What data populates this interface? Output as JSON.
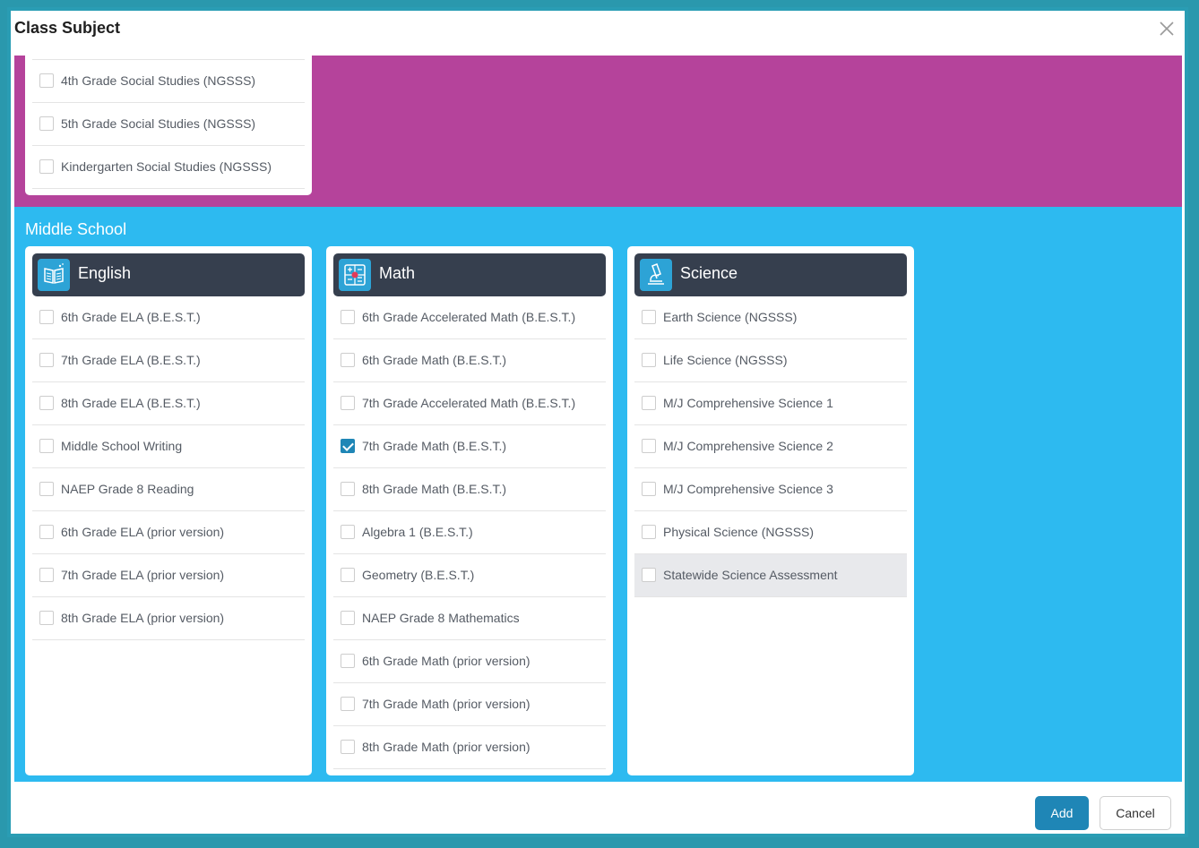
{
  "modal": {
    "title": "Class Subject"
  },
  "elementary_tail": {
    "items": [
      {
        "label": "4th Grade Social Studies (NGSSS)",
        "checked": false
      },
      {
        "label": "5th Grade Social Studies (NGSSS)",
        "checked": false
      },
      {
        "label": "Kindergarten Social Studies (NGSSS)",
        "checked": false
      }
    ]
  },
  "middle_school": {
    "title": "Middle School",
    "english": {
      "label": "English",
      "icon": "book-icon",
      "items": [
        {
          "label": "6th Grade ELA (B.E.S.T.)",
          "checked": false
        },
        {
          "label": "7th Grade ELA (B.E.S.T.)",
          "checked": false
        },
        {
          "label": "8th Grade ELA (B.E.S.T.)",
          "checked": false
        },
        {
          "label": "Middle School Writing",
          "checked": false
        },
        {
          "label": "NAEP Grade 8 Reading",
          "checked": false
        },
        {
          "label": "6th Grade ELA (prior version)",
          "checked": false
        },
        {
          "label": "7th Grade ELA (prior version)",
          "checked": false
        },
        {
          "label": "8th Grade ELA (prior version)",
          "checked": false
        }
      ]
    },
    "math": {
      "label": "Math",
      "icon": "calculator-icon",
      "items": [
        {
          "label": "6th Grade Accelerated Math (B.E.S.T.)",
          "checked": false
        },
        {
          "label": "6th Grade Math (B.E.S.T.)",
          "checked": false
        },
        {
          "label": "7th Grade Accelerated Math (B.E.S.T.)",
          "checked": false
        },
        {
          "label": "7th Grade Math (B.E.S.T.)",
          "checked": true
        },
        {
          "label": "8th Grade Math (B.E.S.T.)",
          "checked": false
        },
        {
          "label": "Algebra 1 (B.E.S.T.)",
          "checked": false
        },
        {
          "label": "Geometry (B.E.S.T.)",
          "checked": false
        },
        {
          "label": "NAEP Grade 8 Mathematics",
          "checked": false
        },
        {
          "label": "6th Grade Math (prior version)",
          "checked": false
        },
        {
          "label": "7th Grade Math (prior version)",
          "checked": false
        },
        {
          "label": "8th Grade Math (prior version)",
          "checked": false
        }
      ]
    },
    "science": {
      "label": "Science",
      "icon": "microscope-icon",
      "items": [
        {
          "label": "Earth Science (NGSSS)",
          "checked": false
        },
        {
          "label": "Life Science (NGSSS)",
          "checked": false
        },
        {
          "label": "M/J Comprehensive Science 1",
          "checked": false
        },
        {
          "label": "M/J Comprehensive Science 2",
          "checked": false
        },
        {
          "label": "M/J Comprehensive Science 3",
          "checked": false
        },
        {
          "label": "Physical Science (NGSSS)",
          "checked": false
        },
        {
          "label": "Statewide Science Assessment",
          "checked": false,
          "hovered": true
        }
      ]
    }
  },
  "footer": {
    "add_label": "Add",
    "cancel_label": "Cancel"
  },
  "colors": {
    "elementary_band": "#b5439b",
    "middle_school_band": "#2dbaf0",
    "card_header": "#363f4e",
    "accent": "#1f86b6"
  }
}
